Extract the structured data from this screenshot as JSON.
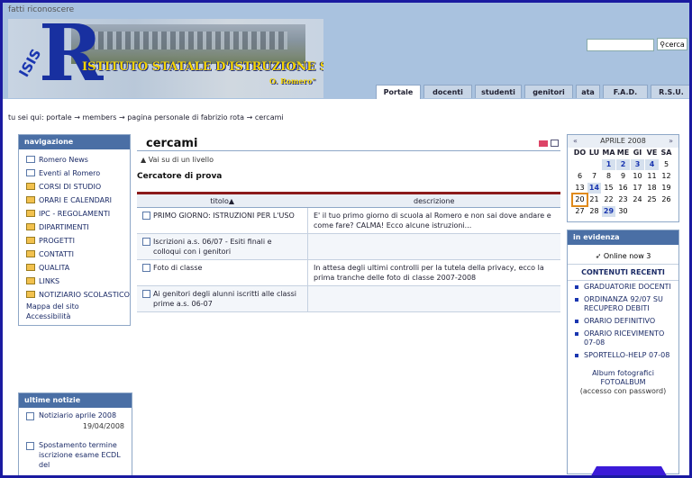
{
  "header": {
    "login_link": "fatti riconoscere",
    "logo_letters": "ISIS",
    "logo_big": "R",
    "institute_name": "ISTITUTO STATALE D'ISTRUZIONE SUPERIORE",
    "institute_sub": "O. Romero\"",
    "search_button": "cerca"
  },
  "tabs": [
    "Portale",
    "docenti",
    "studenti",
    "genitori",
    "ata",
    "F.A.D.",
    "R.S.U."
  ],
  "breadcrumb": "tu sei qui: portale → members → pagina personale di fabrizio rota → cercami",
  "navigation": {
    "title": "navigazione",
    "items": [
      {
        "label": "Romero News",
        "icon": "page-icon"
      },
      {
        "label": "Eventi al Romero",
        "icon": "page-icon"
      },
      {
        "label": "CORSI DI STUDIO",
        "icon": "folder-icon"
      },
      {
        "label": "ORARI E CALENDARI",
        "icon": "folder-icon"
      },
      {
        "label": "IPC - REGOLAMENTI",
        "icon": "folder-icon"
      },
      {
        "label": "DIPARTIMENTI",
        "icon": "folder-icon"
      },
      {
        "label": "PROGETTI",
        "icon": "folder-icon"
      },
      {
        "label": "CONTATTI",
        "icon": "folder-icon"
      },
      {
        "label": "QUALITA",
        "icon": "folder-icon"
      },
      {
        "label": "LINKS",
        "icon": "folder-icon"
      },
      {
        "label": "NOTIZIARIO SCOLASTICO",
        "icon": "folder-icon"
      }
    ],
    "plain_items": [
      "Mappa del sito",
      "Accessibilità"
    ]
  },
  "news": {
    "title": "ultime notizie",
    "items": [
      {
        "label": "Notiziario aprile 2008",
        "date": "19/04/2008"
      },
      {
        "label": "Spostamento termine iscrizione esame ECDL del",
        "date": ""
      }
    ]
  },
  "main": {
    "title": "cercami",
    "up_link": "▲ Vai su di un livello",
    "subtitle": "Cercatore di prova",
    "columns": [
      "titolo▲",
      "descrizione"
    ],
    "rows": [
      {
        "title": "PRIMO GIORNO: ISTRUZIONI PER L'USO",
        "desc": "E' il tuo primo giorno di scuola al Romero e non sai dove andare e come fare? CALMA! Ecco alcune istruzioni..."
      },
      {
        "title": "Iscrizioni a.s. 06/07 - Esiti finali e colloqui con i genitori",
        "desc": ""
      },
      {
        "title": "Foto di classe",
        "desc": "In attesa degli ultimi controlli per la tutela della privacy, ecco la prima tranche delle foto di classe 2007-2008"
      },
      {
        "title": "Ai genitori degli alunni iscritti alle classi prime a.s. 06-07",
        "desc": ""
      }
    ]
  },
  "calendar": {
    "month_label": "APRILE 2008",
    "prev": "«",
    "next": "»",
    "days": [
      "DO",
      "LU",
      "MA",
      "ME",
      "GI",
      "VE",
      "SA"
    ],
    "weeks": [
      [
        "",
        "",
        "1",
        "2",
        "3",
        "4",
        "5"
      ],
      [
        "6",
        "7",
        "8",
        "9",
        "10",
        "11",
        "12"
      ],
      [
        "13",
        "14",
        "15",
        "16",
        "17",
        "18",
        "19"
      ],
      [
        "20",
        "21",
        "22",
        "23",
        "24",
        "25",
        "26"
      ],
      [
        "27",
        "28",
        "29",
        "30",
        "",
        "",
        ""
      ]
    ],
    "event_days": [
      "1",
      "2",
      "3",
      "4",
      "14",
      "29"
    ],
    "today": "20"
  },
  "evidence": {
    "title": "in evidenza",
    "online": "Online now 3",
    "recent_title": "CONTENUTI RECENTI",
    "items": [
      "GRADUATORIE DOCENTI",
      "ORDINANZA 92/07 SU RECUPERO DEBITI",
      "ORARIO DEFINITIVO",
      "ORARIO RICEVIMENTO 07-08",
      "SPORTELLO-HELP 07-08"
    ],
    "album_line1": "Album fotografici",
    "album_line2": "FOTOALBUM",
    "album_line3": "(accesso con password)"
  }
}
